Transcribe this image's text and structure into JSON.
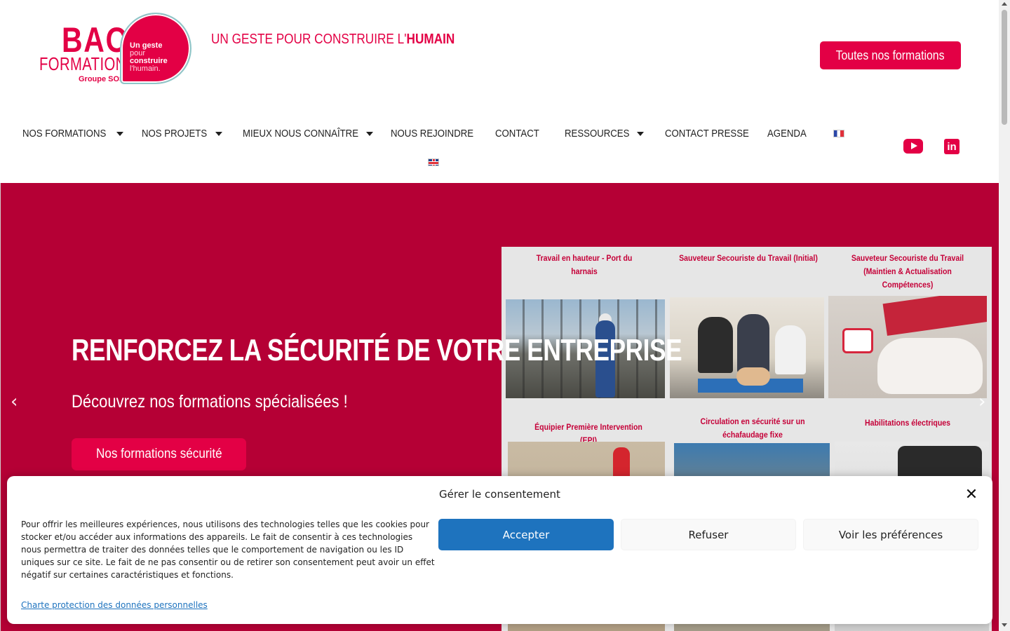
{
  "brand": {
    "logo_top": "BAO",
    "logo_bottom": "FORMATION",
    "logo_group": "Groupe SOS",
    "badge_line1": "Un geste",
    "badge_line2": "pour",
    "badge_line3": "construire",
    "badge_line4": "l'humain.",
    "color_primary": "#e30045",
    "color_hero": "#b50035"
  },
  "header": {
    "tagline_prefix": "UN GESTE POUR CONSTRUIRE L'",
    "tagline_bold": "HUMAIN",
    "cta_label": "Toutes nos formations"
  },
  "nav": {
    "items": [
      {
        "label": "NOS FORMATIONS",
        "has_dropdown": true
      },
      {
        "label": "NOS PROJETS",
        "has_dropdown": true
      },
      {
        "label": "MIEUX NOUS CONNAÎTRE",
        "has_dropdown": true
      },
      {
        "label": "NOUS REJOINDRE",
        "has_dropdown": false
      },
      {
        "label": "CONTACT",
        "has_dropdown": false
      },
      {
        "label": "RESSOURCES",
        "has_dropdown": true
      },
      {
        "label": "CONTACT PRESSE",
        "has_dropdown": false
      },
      {
        "label": "AGENDA",
        "has_dropdown": false
      }
    ],
    "languages": [
      "fr-flag-icon",
      "uk-flag-icon"
    ],
    "social": [
      "youtube-icon",
      "linkedin-icon"
    ],
    "linkedin_glyph": "in"
  },
  "hero": {
    "title": "RENFORCEZ LA SÉCURITÉ DE VOTRE ENTREPRISE",
    "subtitle": "Découvrez nos formations spécialisées !",
    "button_label": "Nos formations sécurité",
    "arrow_prev": "‹",
    "arrow_next": "›",
    "collage_captions": [
      "Travail en hauteur - Port du harnais",
      "Sauveteur Secouriste du Travail (Initial)",
      "Sauveteur Secouriste du Travail (Maintien & Actualisation Compétences)",
      "Équipier Première Intervention (EPI)",
      "Circulation en sécurité sur un échafaudage fixe",
      "Habilitations électriques"
    ]
  },
  "consent": {
    "title": "Gérer le consentement",
    "close_glyph": "✕",
    "body": "Pour offrir les meilleures expériences, nous utilisons des technologies telles que les cookies pour stocker et/ou accéder aux informations des appareils. Le fait de consentir à ces technologies nous permettra de traiter des données telles que le comportement de navigation ou les ID uniques sur ce site. Le fait de ne pas consentir ou de retirer son consentement peut avoir un effet négatif sur certaines caractéristiques et fonctions.",
    "accept_label": "Accepter",
    "refuse_label": "Refuser",
    "prefs_label": "Voir les préférences",
    "policy_link": "Charte protection des données personnelles"
  }
}
